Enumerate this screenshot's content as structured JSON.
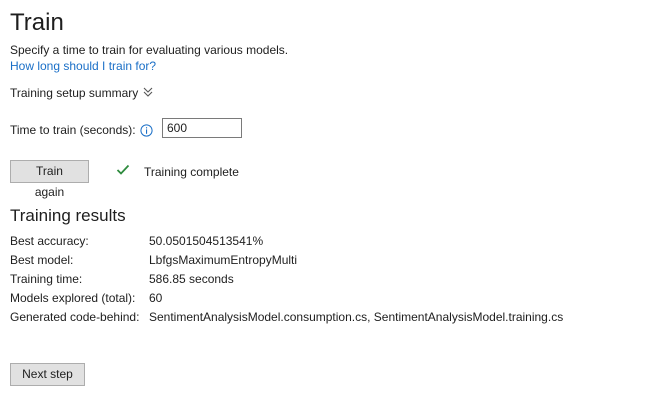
{
  "header": {
    "title": "Train",
    "description": "Specify a time to train for evaluating various models.",
    "help_link": "How long should I train for?"
  },
  "setup": {
    "summary_label": "Training setup summary",
    "summary_icon": "double-chevron-down-icon"
  },
  "time_to_train": {
    "label": "Time to train (seconds):",
    "info_icon": "info-icon",
    "value": "600"
  },
  "actions": {
    "train_again_label": "Train again",
    "next_step_label": "Next step"
  },
  "status": {
    "icon": "checkmark-icon",
    "text": "Training complete",
    "color": "#2e8b3e"
  },
  "results": {
    "title": "Training results",
    "rows": [
      {
        "label": "Best accuracy:",
        "value": "50.0501504513541%"
      },
      {
        "label": "Best model:",
        "value": "LbfgsMaximumEntropyMulti"
      },
      {
        "label": "Training time:",
        "value": "586.85 seconds"
      },
      {
        "label": "Models explored (total):",
        "value": "60"
      },
      {
        "label": "Generated code-behind:",
        "value": "SentimentAnalysisModel.consumption.cs, SentimentAnalysisModel.training.cs"
      }
    ]
  },
  "colors": {
    "link": "#1a6fc7",
    "text": "#1e1e1e",
    "button_bg": "#e1e1e1",
    "button_border": "#adadad"
  }
}
